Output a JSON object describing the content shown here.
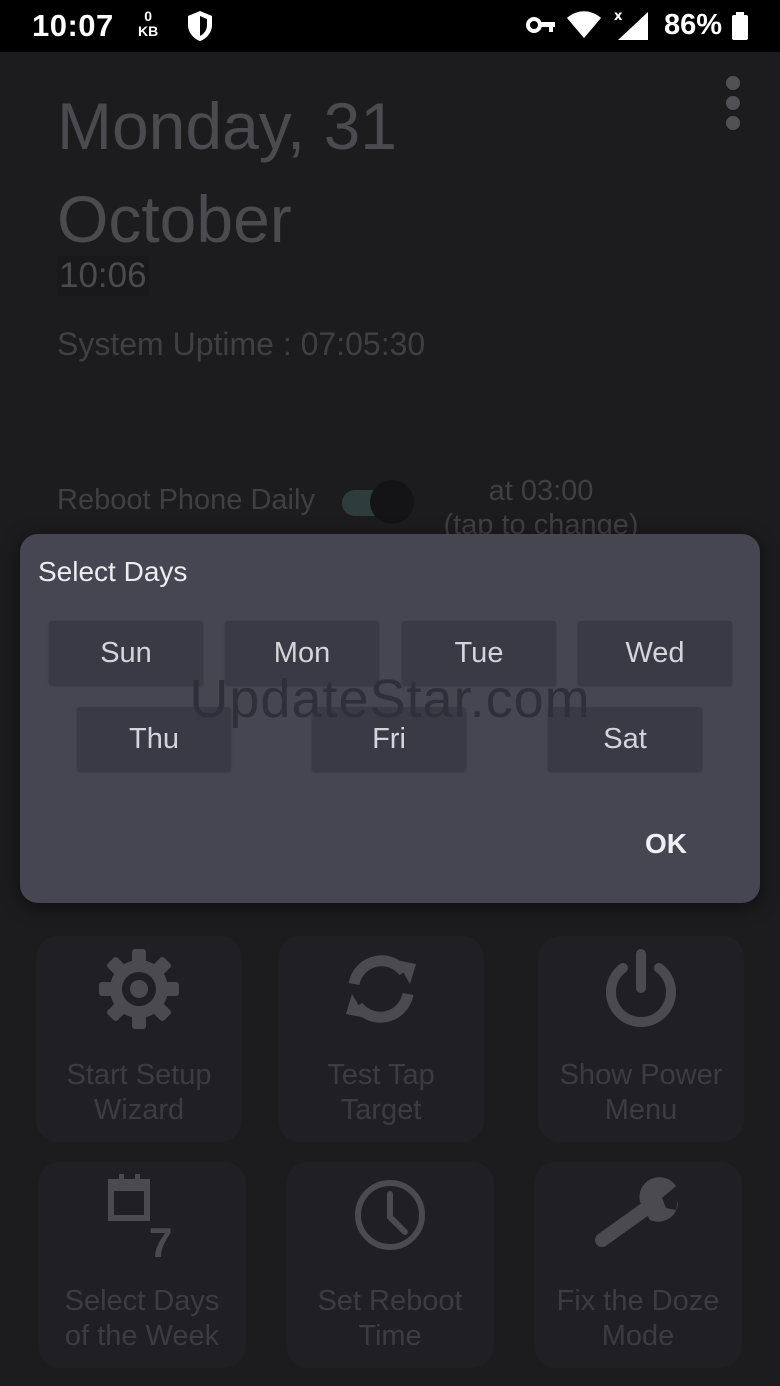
{
  "status_bar": {
    "time": "10:07",
    "net_speed_value": "0",
    "net_speed_unit": "KB",
    "battery": "86%",
    "icons": [
      "shield-icon",
      "vpn-key-icon",
      "wifi-icon",
      "signal-icon",
      "battery-icon"
    ]
  },
  "app": {
    "date_line1": "Monday, 31",
    "date_line2": "October",
    "time": "10:06",
    "uptime": "System Uptime : 07:05:30",
    "reboot_daily_label": "Reboot Phone Daily",
    "reboot_daily_enabled": true,
    "reboot_time_line1": "at 03:00",
    "reboot_time_line2": "(tap to change)",
    "tiles": [
      {
        "line1": "Start Setup",
        "line2": "Wizard",
        "icon": "gear-icon"
      },
      {
        "line1": "Test Tap",
        "line2": "Target",
        "icon": "refresh-icon"
      },
      {
        "line1": "Show Power",
        "line2": "Menu",
        "icon": "power-icon"
      },
      {
        "line1": "Select Days",
        "line2": "of the Week",
        "icon": "calendar-7-icon"
      },
      {
        "line1": "Set Reboot",
        "line2": "Time",
        "icon": "clock-icon"
      },
      {
        "line1": "Fix the Doze",
        "line2": "Mode",
        "icon": "wrench-icon"
      }
    ]
  },
  "dialog": {
    "title": "Select Days",
    "days": [
      "Sun",
      "Mon",
      "Tue",
      "Wed",
      "Thu",
      "Fri",
      "Sat"
    ],
    "ok_label": "OK"
  },
  "watermark": "UpdateStar.com",
  "colors": {
    "dialog_bg": "#454652",
    "day_button_bg": "#393a46",
    "app_bg": "#1c1c1f",
    "status_bar_bg": "#000000"
  }
}
